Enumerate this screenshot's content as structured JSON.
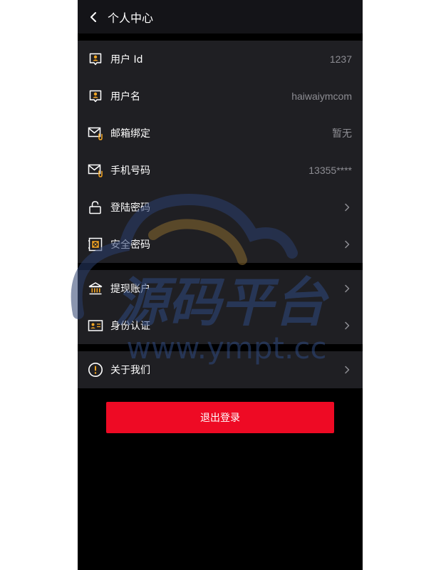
{
  "header": {
    "title": "个人中心"
  },
  "groups": {
    "account": {
      "rows": [
        {
          "label": "用户 Id",
          "value": "1237",
          "icon": "user-id-icon"
        },
        {
          "label": "用户名",
          "value": "haiwaiymcom",
          "icon": "user-icon"
        },
        {
          "label": "邮箱绑定",
          "value": "暂无",
          "icon": "mail-icon"
        },
        {
          "label": "手机号码",
          "value": "13355****",
          "icon": "phone-mail-icon"
        },
        {
          "label": "登陆密码",
          "value": "",
          "icon": "unlock-icon"
        },
        {
          "label": "安全密码",
          "value": "",
          "icon": "safe-icon"
        }
      ]
    },
    "finance": {
      "rows": [
        {
          "label": "提现账户",
          "icon": "bank-icon"
        },
        {
          "label": "身份认证",
          "icon": "id-card-icon"
        }
      ]
    },
    "about": {
      "rows": [
        {
          "label": "关于我们",
          "icon": "info-icon"
        }
      ]
    }
  },
  "logout": {
    "label": "退出登录"
  },
  "watermark": {
    "title": "源码平台",
    "url": "www.ympt.cc"
  },
  "colors": {
    "accent": "#f5a623",
    "danger": "#ee0a24",
    "background": "#000000",
    "card": "#1f1f23",
    "header": "#141418",
    "muted_text": "#8d8d93"
  }
}
